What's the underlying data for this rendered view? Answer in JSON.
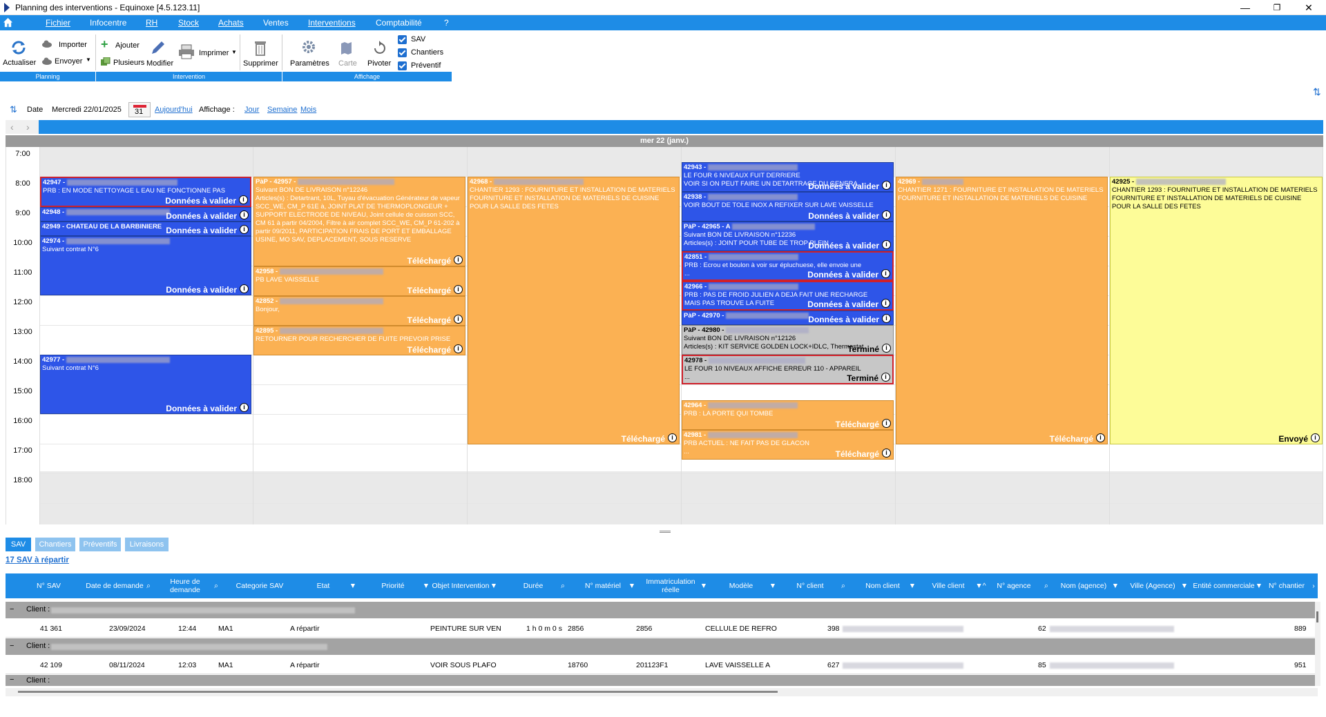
{
  "window": {
    "title": "Planning des interventions - Equinoxe [4.5.123.11]"
  },
  "menu": [
    "Fichier",
    "Infocentre",
    "RH",
    "Stock",
    "Achats",
    "Ventes",
    "Interventions",
    "Comptabilité",
    "?"
  ],
  "ribbon": {
    "actualiser": "Actualiser",
    "importer": "Importer",
    "envoyer": "Envoyer",
    "ajouter": "Ajouter",
    "plusieurs": "Plusieurs",
    "modifier": "Modifier",
    "imprimer": "Imprimer",
    "supprimer": "Supprimer",
    "parametres": "Paramètres",
    "carte": "Carte",
    "pivoter": "Pivoter",
    "sav": "SAV",
    "chantiers": "Chantiers",
    "preventif": "Préventif",
    "groups": [
      "Planning",
      "Intervention",
      "Affichage"
    ]
  },
  "datebar": {
    "date_label": "Date",
    "date_value": "Mercredi 22/01/2025",
    "calendar_day": "31",
    "today": "Aujourd'hui",
    "affichage": "Affichage :",
    "jour": "Jour",
    "semaine": "Semaine",
    "mois": "Mois"
  },
  "day_header": "mer 22 (janv.)",
  "hours": [
    "7:00",
    "8:00",
    "9:00",
    "10:00",
    "11:00",
    "12:00",
    "13:00",
    "14:00",
    "15:00",
    "16:00",
    "17:00",
    "18:00"
  ],
  "events": {
    "e42947": {
      "id": "42947 -",
      "l1": "PRB : EN MODE NETTOYAGE L EAU NE FONCTIONNE PAS",
      "st": "Données à valider"
    },
    "e42948": {
      "id": "42948 -",
      "st": "Données à valider"
    },
    "e42949": {
      "id": "42949 - CHATEAU DE LA BARBINIERE",
      "st": "Données à valider"
    },
    "e42974": {
      "id": "42974 -",
      "l1": "Suivant contrat N°6",
      "st": "Données à valider"
    },
    "e42977": {
      "id": "42977 -",
      "l1": "Suivant contrat N°6",
      "st": "Données à valider"
    },
    "e42957": {
      "id": "PàP - 42957 -",
      "l1": "Suivant BON DE LIVRAISON n°12246",
      "l2": "Articles(s) : Detartrant, 10L, Tuyau d'évacuation Générateur de vapeur SCC_WE, CM_P 61E à, JOINT PLAT DE THERMOPLONGEUR + SUPPORT ELECTRODE DE NIVEAU, Joint cellule de cuisson SCC, CM 61 à partir 04/2004, Filtre à air complet SCC_WE, CM_P 61-202 à partir 09/2011, PARTICIPATION FRAIS DE PORT ET EMBALLAGE USINE, MO SAV, DEPLACEMENT, SOUS RESERVE",
      "st": "Téléchargé"
    },
    "e42958": {
      "id": "42958 -",
      "l1": "PB LAVE VAISSELLE",
      "st": "Téléchargé"
    },
    "e42852": {
      "id": "42852 -",
      "l1": "Bonjour,",
      "st": "Téléchargé"
    },
    "e42895": {
      "id": "42895 -",
      "l1": "RETOURNER POUR RECHERCHER DE FUITE PREVOIR PRISE",
      "st": "Téléchargé"
    },
    "e42968": {
      "id": "42968 -",
      "l1": "CHANTIER 1293 : FOURNITURE ET INSTALLATION DE MATERIELS",
      "l2": "FOURNITURE ET INSTALLATION DE MATERIELS DE CUISINE POUR LA SALLE DES FETES",
      "st": "Téléchargé"
    },
    "e42943": {
      "id": "42943 -",
      "l1": "LE FOUR 6 NIVEAUX FUIT DERRIERE",
      "l2": "VOIR SI ON PEUT FAIRE UN DETARTRAGE DU GENERA",
      "st": "Données à valider"
    },
    "e42938": {
      "id": "42938 -",
      "l1": "VOIR BOUT DE TOLE INOX A REFIXER SUR LAVE VAISSELLE",
      "st": "Données à valider"
    },
    "e42965": {
      "id": "PàP - 42965 - A",
      "l1": "Suivant BON DE LIVRAISON n°12236",
      "l2": "Articles(s) : JOINT POUR TUBE DE TROP PLEIN",
      "st": "Données à valider"
    },
    "e42851": {
      "id": "42851 -",
      "l1": "PRB : Ecrou et boulon à voir sur épluchuese, elle envoie une",
      "l2": "...",
      "st": "Données à valider"
    },
    "e42966": {
      "id": "42966 -",
      "l1": "PRB : PAS DE FROID JULIEN A DEJA FAIT UNE RECHARGE",
      "l2": "MAIS PAS TROUVE LA FUITE",
      "st": "Données à valider"
    },
    "e42970": {
      "id": "PàP - 42970 -",
      "st": "Données à valider"
    },
    "e42980": {
      "id": "PàP - 42980 -",
      "l1": "Suivant BON DE LIVRAISON n°12126",
      "l2": "Articles(s) : KIT SERVICE GOLDEN LOCK+IDLC, Thermostat",
      "st": "Terminé"
    },
    "e42978": {
      "id": "42978 -",
      "l1": "LE FOUR 10 NIVEAUX AFFICHE ERREUR 110 - APPAREIL",
      "l2": "...",
      "st": "Terminé"
    },
    "e42964": {
      "id": "42964 -",
      "l1": "PRB : LA PORTE QUI TOMBE",
      "st": "Téléchargé"
    },
    "e42981": {
      "id": "42981 -",
      "l1": "PRB ACTUEL : NE FAIT PAS DE GLACON",
      "l2": "...",
      "st": "Téléchargé"
    },
    "e42969": {
      "id": "42969 -",
      "l1": "CHANTIER 1271 : FOURNITURE ET INSTALLATION DE MATERIELS",
      "l2": "FOURNITURE ET INSTALLATION DE MATERIELS DE CUISINE",
      "st": "Téléchargé"
    },
    "e42925": {
      "id": "42925 -",
      "l1": "CHANTIER 1293 : FOURNITURE ET INSTALLATION DE MATERIELS",
      "l2": "FOURNITURE ET INSTALLATION DE MATERIELS DE CUISINE POUR LA SALLE DES FETES",
      "st": "Envoyé"
    }
  },
  "tabs": [
    "SAV",
    "Chantiers",
    "Préventifs",
    "Livraisons"
  ],
  "count_link": "17 SAV à répartir",
  "columns": [
    "N° SAV",
    "Date de demande",
    "Heure de demande",
    "Categorie SAV",
    "Etat",
    "Priorité",
    "Objet Intervention",
    "Durée",
    "N° matériel",
    "Immatriculation réelle",
    "Modèle",
    "N° client",
    "Nom client",
    "Ville client",
    "N° agence",
    "Nom (agence)",
    "Ville (Agence)",
    "Entité commerciale",
    "N° chantier"
  ],
  "group_label": "Client :",
  "rows": [
    {
      "nsav": "41 361",
      "date": "23/09/2024",
      "heure": "12:44",
      "cat": "MA1",
      "etat": "A répartir",
      "objet": "PEINTURE SUR VEN",
      "duree": "1 h 0 m 0 s",
      "nmat": "2856",
      "immat": "2856",
      "modele": "CELLULE DE REFRO",
      "nclient": "398",
      "nagence": "62",
      "nchantier": "889"
    },
    {
      "nsav": "42 109",
      "date": "08/11/2024",
      "heure": "12:03",
      "cat": "MA1",
      "etat": "A répartir",
      "objet": "VOIR SOUS PLAFO",
      "duree": "",
      "nmat": "18760",
      "immat": "201123F1",
      "modele": "LAVE VAISSELLE A",
      "nclient": "627",
      "nagence": "85",
      "nchantier": "951"
    }
  ],
  "colors": {
    "accent": "#1e8ce6",
    "event_blue": "#2e55e8",
    "event_orange": "#fbb153",
    "event_yellow": "#fdfc98",
    "event_gray": "#c7c7c7",
    "alert_red": "#d0202a"
  }
}
